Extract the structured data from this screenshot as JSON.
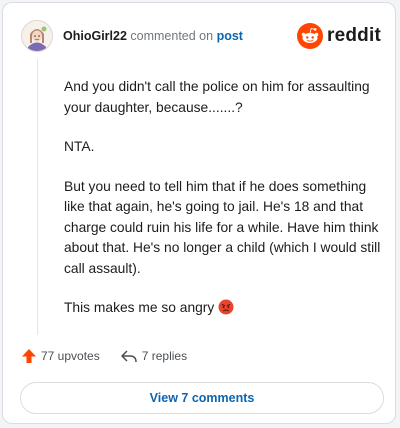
{
  "header": {
    "username": "OhioGirl22",
    "connector": "commented on",
    "post_link": "post",
    "brand": "reddit",
    "brand_color": "#ff4500",
    "avatar_icon": "user-avatar"
  },
  "comment": {
    "paragraphs": [
      "And you didn't call the police on him for assaulting your daughter, because.......?",
      "NTA.",
      "But you need to tell him that if he does something like that again, he's going to jail. He's 18 and that charge could ruin his life for a while. Have him think about that. He's no longer a child (which I would still call assault).",
      "This makes me so angry"
    ],
    "emoji": "angry-face-icon"
  },
  "actions": {
    "upvotes": "77 upvotes",
    "upvote_icon": "upvote-arrow-icon",
    "upvote_color": "#ff4500",
    "replies": "7 replies",
    "reply_icon": "reply-icon"
  },
  "footer": {
    "view_comments": "View 7 comments"
  }
}
